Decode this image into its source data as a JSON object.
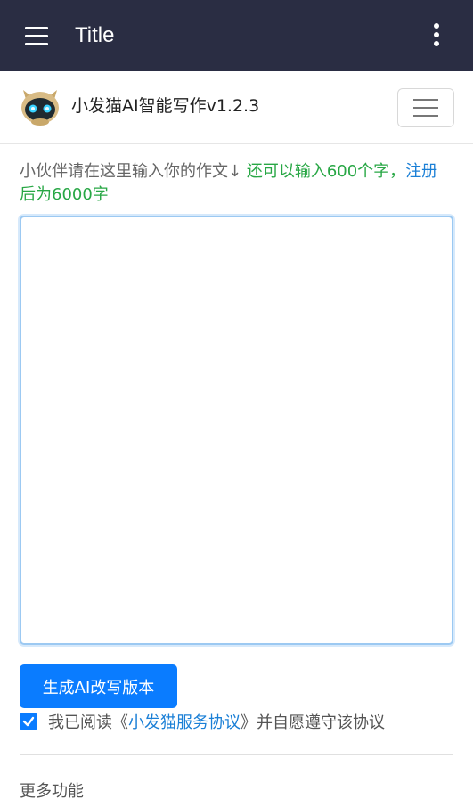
{
  "appbar": {
    "title": "Title",
    "menu_icon": "hamburger-menu-icon",
    "overflow_icon": "more-vert-icon",
    "background": "#2a2d43"
  },
  "navbar": {
    "brand": "小发猫AI智能写作v1.2.3",
    "logo_icon": "cat-robot-logo",
    "toggler_icon": "hamburger-toggle-icon"
  },
  "prompt": {
    "instruction": "小伙伴请在这里输入你的作文↓",
    "remaining": "还可以输入600个字，",
    "register_link": "注册",
    "after_register": "后为6000字"
  },
  "essay": {
    "value": "",
    "placeholder": ""
  },
  "actions": {
    "generate_label": "生成AI改写版本",
    "accent": "#0a7cff"
  },
  "agreement": {
    "checked": true,
    "prefix": "我已阅读《",
    "link": "小发猫服务协议",
    "suffix": "》并自愿遵守该协议"
  },
  "more": {
    "label": "更多功能"
  }
}
